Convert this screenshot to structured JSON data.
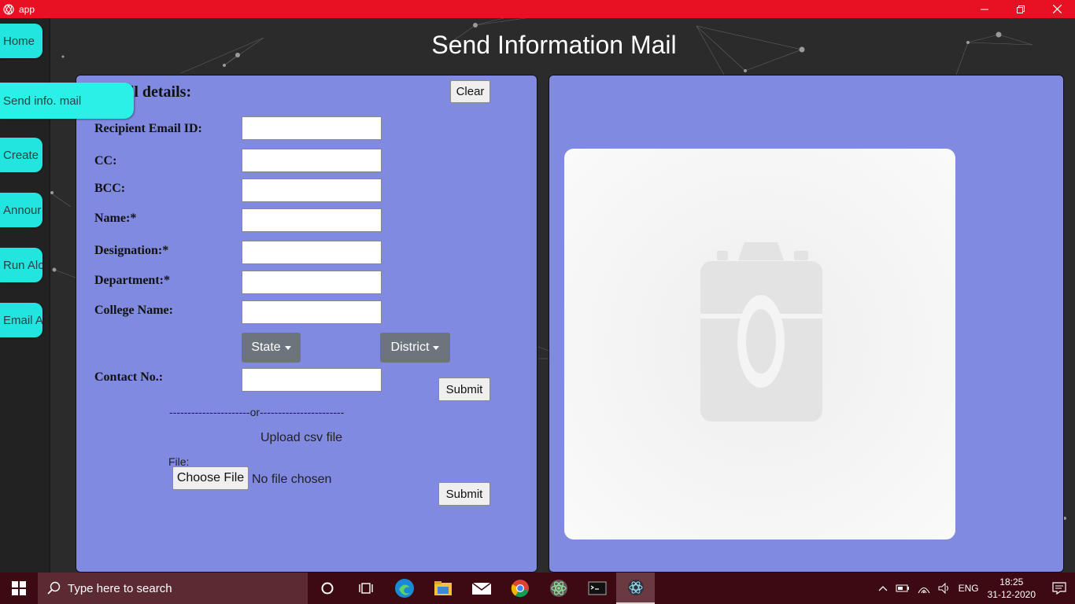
{
  "window": {
    "title": "app"
  },
  "nav": {
    "items": [
      {
        "label": "Home"
      },
      {
        "label": "Send info. mail"
      },
      {
        "label": "Create"
      },
      {
        "label": "Annour"
      },
      {
        "label": "Run Alc"
      },
      {
        "label": "Email A"
      }
    ]
  },
  "page": {
    "title": "Send Information Mail"
  },
  "form": {
    "heading": "Fill details:",
    "clear_label": "Clear",
    "labels": {
      "recipient": "Recipient Email ID:",
      "cc": "CC:",
      "bcc": "BCC:",
      "name": "Name:*",
      "designation": "Designation:*",
      "department": "Department:*",
      "college": "College Name:",
      "contact": "Contact No.:"
    },
    "state_label": "State",
    "district_label": "District",
    "submit_label": "Submit",
    "divider": "----------------------or-----------------------",
    "upload_text": "Upload csv file",
    "file_label": "File:",
    "choose_file_label": "Choose File",
    "no_file_text": "No file chosen",
    "submit2_label": "Submit"
  },
  "preview": {
    "icon": "camera-placeholder-icon"
  },
  "taskbar": {
    "search_placeholder": "Type here to search",
    "apps": [
      "cortana-icon",
      "task-view-icon",
      "edge-icon",
      "file-explorer-icon",
      "mail-icon",
      "chrome-icon",
      "atom-icon",
      "terminal-icon",
      "electron-icon"
    ],
    "tray_language": "ENG",
    "time": "18:25",
    "date": "31-12-2020"
  },
  "colors": {
    "titlebar": "#e81123",
    "panel": "#7f8ae0",
    "nav_button": "#22e5e0",
    "dropdown": "#6c757d",
    "taskbar": "#3c0a10"
  }
}
